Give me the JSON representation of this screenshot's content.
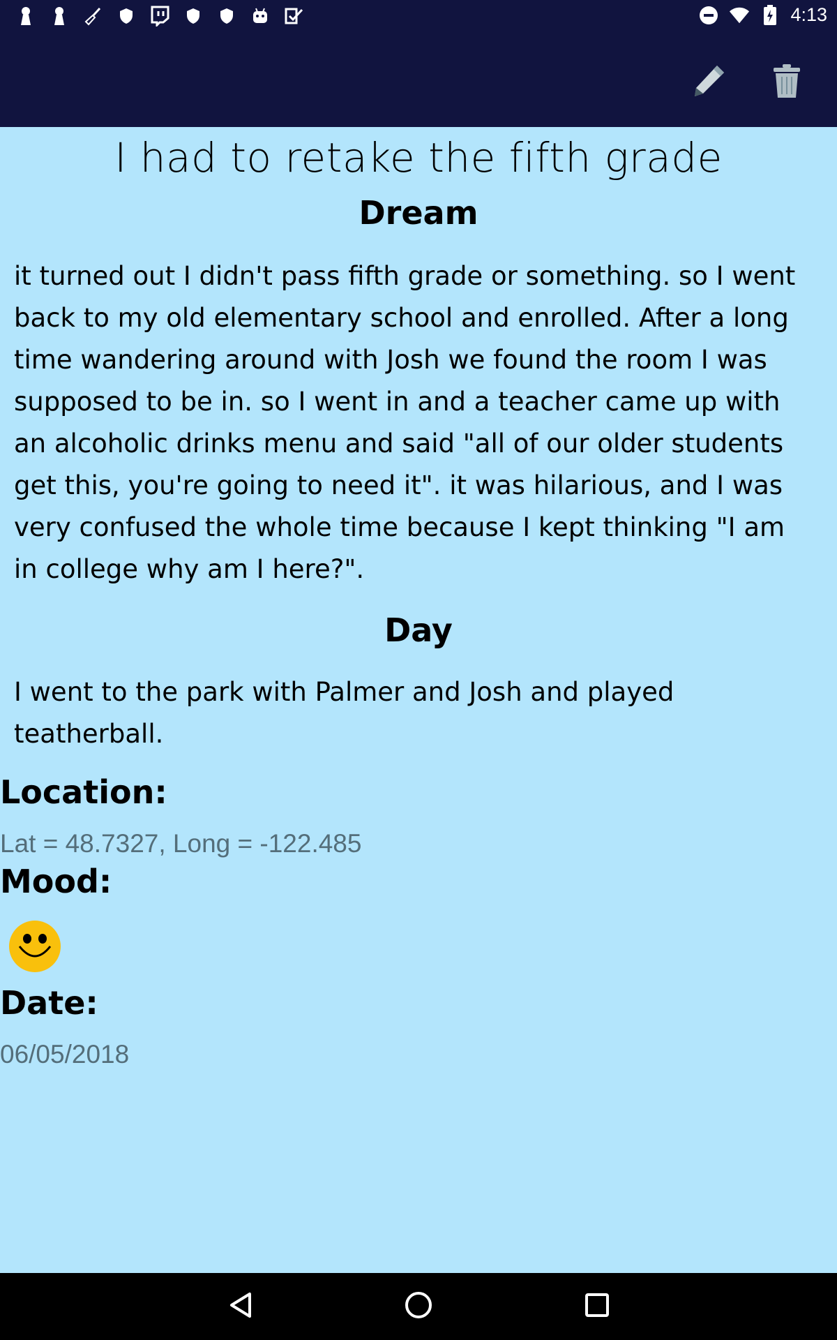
{
  "status_bar": {
    "time": "4:13",
    "left_icons": [
      "keyhole-icon",
      "keyhole-icon",
      "broom-icon",
      "shield-icon",
      "twitch-icon",
      "shield-icon",
      "shield-icon",
      "android-icon",
      "check-icon"
    ],
    "right_icons": [
      "do-not-disturb-icon",
      "wifi-icon",
      "battery-charging-icon"
    ]
  },
  "app_bar": {
    "actions": [
      "pencil-icon",
      "trash-icon"
    ],
    "background": "#11143f"
  },
  "entry": {
    "title": "I had to retake the fifth grade",
    "dream_heading": "Dream",
    "dream_text": "it turned out I didn't pass fifth grade or something. so I went back to my old elementary school and enrolled. After a long time wandering around with Josh we found the room I was supposed to be in. so I went in and a teacher came up with an alcoholic drinks menu and said \"all of our older students get this, you're going to need it\". it was hilarious, and I was very confused the whole time because I kept thinking \"I am in college why am I here?\".",
    "day_heading": "Day",
    "day_text": "I went to the park with Palmer and Josh and played teatherball.",
    "location_label": "Location:",
    "location_value": "Lat = 48.7327, Long = -122.485",
    "mood_label": "Mood:",
    "mood_icon": "happy-face-icon",
    "date_label": "Date:",
    "date_value": "06/05/2018"
  },
  "colors": {
    "content_background": "#b3e5fc",
    "value_text": "#546e7a",
    "mood_face": "#f9c00c"
  },
  "nav_bar": [
    "back-icon",
    "home-icon",
    "recents-icon"
  ]
}
